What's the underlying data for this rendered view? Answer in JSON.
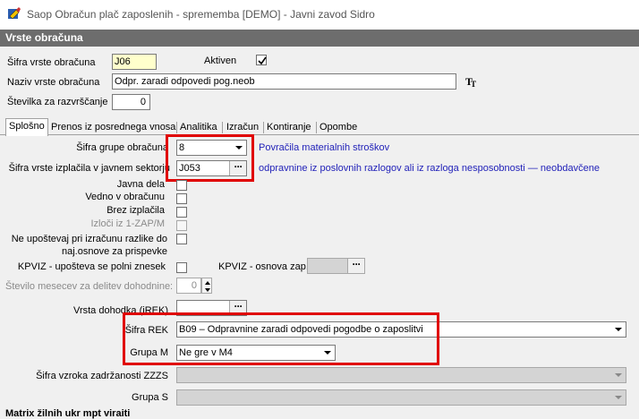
{
  "window": {
    "title": "Saop Obračun plač zaposlenih - sprememba [DEMO] - Javni zavod Sidro"
  },
  "section": {
    "title": "Vrste obračuna"
  },
  "header": {
    "sifra_label": "Šifra vrste obračuna",
    "sifra_value": "J06",
    "aktiven_label": "Aktiven",
    "aktiven_checked": true,
    "naziv_label": "Naziv vrste obračuna",
    "naziv_value": "Odpr. zaradi odpovedi pog.neob",
    "stevilka_label": "Številka  za razvrščanje",
    "stevilka_value": "0"
  },
  "tabs": [
    {
      "label": "Splošno",
      "active": true
    },
    {
      "label": "Prenos iz posrednega vnosa",
      "active": false
    },
    {
      "label": "Analitika",
      "active": false
    },
    {
      "label": "Izračun",
      "active": false
    },
    {
      "label": "Kontiranje",
      "active": false
    },
    {
      "label": "Opombe",
      "active": false
    }
  ],
  "form": {
    "sifra_grupe_label": "Šifra grupe obračuna",
    "sifra_grupe_value": "8",
    "sifra_grupe_desc": "Povračila materialnih stroškov",
    "sifra_izplacila_label": "Šifra vrste izplačila v javnem sektorju",
    "sifra_izplacila_value": "J053",
    "sifra_izplacila_desc": "odpravnine  iz poslovnih razlogov ali iz razloga nesposobnosti — neobdavčene",
    "javna_dela_label": "Javna dela",
    "vedno_label": "Vedno v obračunu",
    "brez_label": "Brez izplačila",
    "izloci_label": "Izloči iz 1-ZAP/M",
    "ne_upostevaj_line1": "Ne upoštevaj pri izračunu razlike do",
    "ne_upostevaj_line2": "naj.osnove za prispevke",
    "kpviz_label": "KPVIZ - upošteva se polni znesek",
    "kpviz_osnova_label": "KPVIZ - osnova zap.",
    "stevilo_label": "Število mesecev za delitev dohodnine:",
    "stevilo_value": "0",
    "vrsta_label": "Vrsta dohodka (iREK)",
    "sifra_rek_label": "Šifra REK",
    "sifra_rek_value": "B09 – Odpravnine zaradi odpovedi pogodbe o zaposlitvi",
    "grupa_m_label": "Grupa M",
    "grupa_m_value": "Ne gre v M4",
    "vzrok_label": "Šifra vzroka zadržanosti ZZZS",
    "grupa_s_label": "Grupa S",
    "bottom_text": "Matrix žilnih ukr mpt viraiti"
  },
  "colors": {
    "highlight": "#e00000",
    "link": "#1f1fb8",
    "header_bg": "#6d6d6d"
  }
}
